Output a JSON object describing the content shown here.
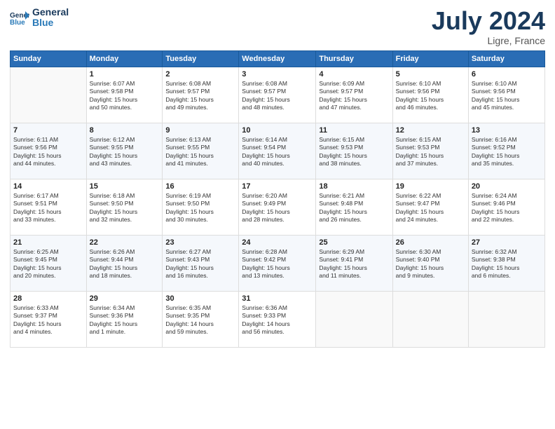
{
  "header": {
    "logo_line1": "General",
    "logo_line2": "Blue",
    "month": "July 2024",
    "location": "Ligre, France"
  },
  "weekdays": [
    "Sunday",
    "Monday",
    "Tuesday",
    "Wednesday",
    "Thursday",
    "Friday",
    "Saturday"
  ],
  "weeks": [
    [
      {
        "day": "",
        "info": ""
      },
      {
        "day": "1",
        "info": "Sunrise: 6:07 AM\nSunset: 9:58 PM\nDaylight: 15 hours\nand 50 minutes."
      },
      {
        "day": "2",
        "info": "Sunrise: 6:08 AM\nSunset: 9:57 PM\nDaylight: 15 hours\nand 49 minutes."
      },
      {
        "day": "3",
        "info": "Sunrise: 6:08 AM\nSunset: 9:57 PM\nDaylight: 15 hours\nand 48 minutes."
      },
      {
        "day": "4",
        "info": "Sunrise: 6:09 AM\nSunset: 9:57 PM\nDaylight: 15 hours\nand 47 minutes."
      },
      {
        "day": "5",
        "info": "Sunrise: 6:10 AM\nSunset: 9:56 PM\nDaylight: 15 hours\nand 46 minutes."
      },
      {
        "day": "6",
        "info": "Sunrise: 6:10 AM\nSunset: 9:56 PM\nDaylight: 15 hours\nand 45 minutes."
      }
    ],
    [
      {
        "day": "7",
        "info": "Sunrise: 6:11 AM\nSunset: 9:56 PM\nDaylight: 15 hours\nand 44 minutes."
      },
      {
        "day": "8",
        "info": "Sunrise: 6:12 AM\nSunset: 9:55 PM\nDaylight: 15 hours\nand 43 minutes."
      },
      {
        "day": "9",
        "info": "Sunrise: 6:13 AM\nSunset: 9:55 PM\nDaylight: 15 hours\nand 41 minutes."
      },
      {
        "day": "10",
        "info": "Sunrise: 6:14 AM\nSunset: 9:54 PM\nDaylight: 15 hours\nand 40 minutes."
      },
      {
        "day": "11",
        "info": "Sunrise: 6:15 AM\nSunset: 9:53 PM\nDaylight: 15 hours\nand 38 minutes."
      },
      {
        "day": "12",
        "info": "Sunrise: 6:15 AM\nSunset: 9:53 PM\nDaylight: 15 hours\nand 37 minutes."
      },
      {
        "day": "13",
        "info": "Sunrise: 6:16 AM\nSunset: 9:52 PM\nDaylight: 15 hours\nand 35 minutes."
      }
    ],
    [
      {
        "day": "14",
        "info": "Sunrise: 6:17 AM\nSunset: 9:51 PM\nDaylight: 15 hours\nand 33 minutes."
      },
      {
        "day": "15",
        "info": "Sunrise: 6:18 AM\nSunset: 9:50 PM\nDaylight: 15 hours\nand 32 minutes."
      },
      {
        "day": "16",
        "info": "Sunrise: 6:19 AM\nSunset: 9:50 PM\nDaylight: 15 hours\nand 30 minutes."
      },
      {
        "day": "17",
        "info": "Sunrise: 6:20 AM\nSunset: 9:49 PM\nDaylight: 15 hours\nand 28 minutes."
      },
      {
        "day": "18",
        "info": "Sunrise: 6:21 AM\nSunset: 9:48 PM\nDaylight: 15 hours\nand 26 minutes."
      },
      {
        "day": "19",
        "info": "Sunrise: 6:22 AM\nSunset: 9:47 PM\nDaylight: 15 hours\nand 24 minutes."
      },
      {
        "day": "20",
        "info": "Sunrise: 6:24 AM\nSunset: 9:46 PM\nDaylight: 15 hours\nand 22 minutes."
      }
    ],
    [
      {
        "day": "21",
        "info": "Sunrise: 6:25 AM\nSunset: 9:45 PM\nDaylight: 15 hours\nand 20 minutes."
      },
      {
        "day": "22",
        "info": "Sunrise: 6:26 AM\nSunset: 9:44 PM\nDaylight: 15 hours\nand 18 minutes."
      },
      {
        "day": "23",
        "info": "Sunrise: 6:27 AM\nSunset: 9:43 PM\nDaylight: 15 hours\nand 16 minutes."
      },
      {
        "day": "24",
        "info": "Sunrise: 6:28 AM\nSunset: 9:42 PM\nDaylight: 15 hours\nand 13 minutes."
      },
      {
        "day": "25",
        "info": "Sunrise: 6:29 AM\nSunset: 9:41 PM\nDaylight: 15 hours\nand 11 minutes."
      },
      {
        "day": "26",
        "info": "Sunrise: 6:30 AM\nSunset: 9:40 PM\nDaylight: 15 hours\nand 9 minutes."
      },
      {
        "day": "27",
        "info": "Sunrise: 6:32 AM\nSunset: 9:38 PM\nDaylight: 15 hours\nand 6 minutes."
      }
    ],
    [
      {
        "day": "28",
        "info": "Sunrise: 6:33 AM\nSunset: 9:37 PM\nDaylight: 15 hours\nand 4 minutes."
      },
      {
        "day": "29",
        "info": "Sunrise: 6:34 AM\nSunset: 9:36 PM\nDaylight: 15 hours\nand 1 minute."
      },
      {
        "day": "30",
        "info": "Sunrise: 6:35 AM\nSunset: 9:35 PM\nDaylight: 14 hours\nand 59 minutes."
      },
      {
        "day": "31",
        "info": "Sunrise: 6:36 AM\nSunset: 9:33 PM\nDaylight: 14 hours\nand 56 minutes."
      },
      {
        "day": "",
        "info": ""
      },
      {
        "day": "",
        "info": ""
      },
      {
        "day": "",
        "info": ""
      }
    ]
  ]
}
